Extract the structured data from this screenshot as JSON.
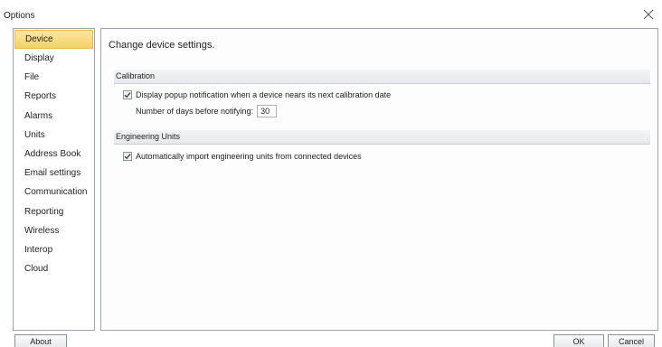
{
  "window": {
    "title": "Options",
    "close_icon": "close-icon"
  },
  "sidebar": {
    "items": [
      {
        "label": "Device",
        "selected": true
      },
      {
        "label": "Display"
      },
      {
        "label": "File"
      },
      {
        "label": "Reports"
      },
      {
        "label": "Alarms"
      },
      {
        "label": "Units"
      },
      {
        "label": "Address Book"
      },
      {
        "label": "Email settings"
      },
      {
        "label": "Communication"
      },
      {
        "label": "Reporting"
      },
      {
        "label": "Wireless"
      },
      {
        "label": "Interop"
      },
      {
        "label": "Cloud"
      }
    ]
  },
  "content": {
    "title": "Change device settings.",
    "calibration": {
      "section_label": "Calibration",
      "popup_notification_label": "Display popup notification when a device nears its next calibration date",
      "popup_notification_checked": true,
      "days_label": "Number of days before notifying:",
      "days_value": "30"
    },
    "engineering_units": {
      "section_label": "Engineering Units",
      "auto_import_label": "Automatically import engineering units from connected devices",
      "auto_import_checked": true
    }
  },
  "footer": {
    "about_label": "About",
    "ok_label": "OK",
    "cancel_label": "Cancel"
  },
  "colors": {
    "selected_item_bg": "#f7cf66",
    "border": "#9aa6b4"
  }
}
